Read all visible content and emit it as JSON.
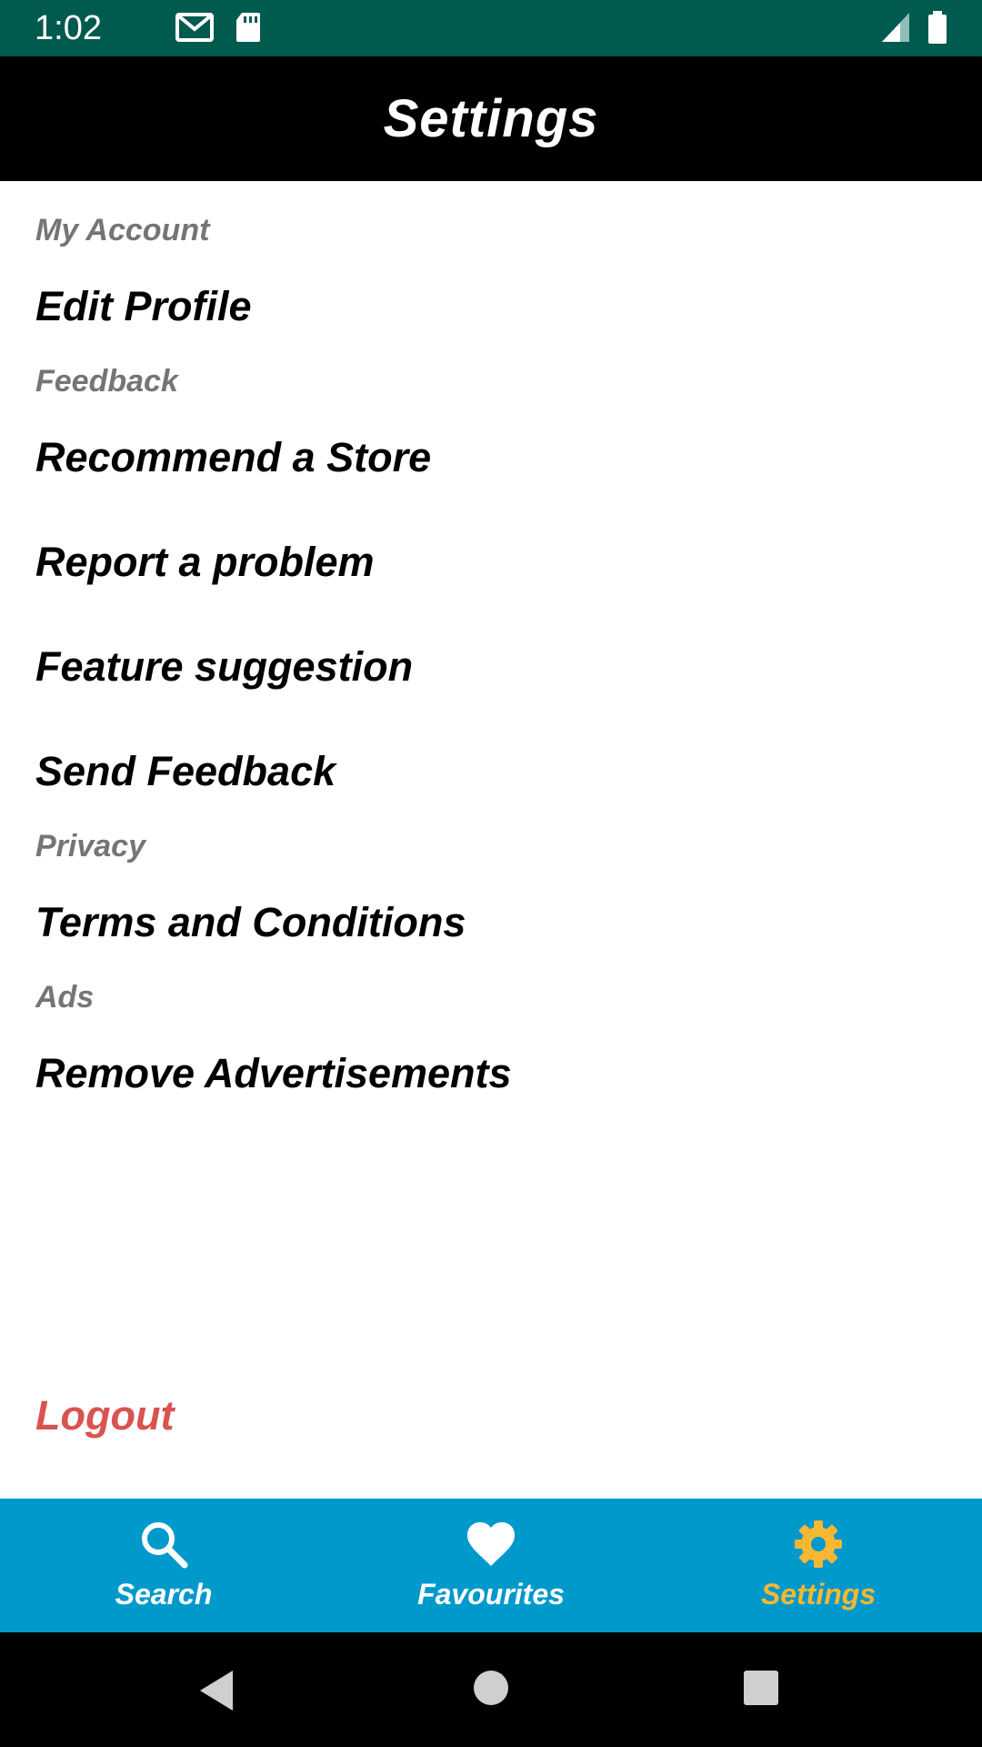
{
  "status_bar": {
    "time": "1:02",
    "icons": [
      "gmail-icon",
      "sd-card-icon",
      "signal-icon",
      "battery-icon"
    ]
  },
  "app_bar": {
    "title": "Settings"
  },
  "sections": [
    {
      "header": "My Account",
      "items": [
        "Edit Profile"
      ]
    },
    {
      "header": "Feedback",
      "items": [
        "Recommend a Store",
        "Report a problem",
        "Feature suggestion",
        "Send Feedback"
      ]
    },
    {
      "header": "Privacy",
      "items": [
        "Terms and Conditions"
      ]
    },
    {
      "header": "Ads",
      "items": [
        "Remove Advertisements"
      ]
    }
  ],
  "logout_label": "Logout",
  "bottom_nav": {
    "items": [
      {
        "label": "Search",
        "icon": "search-icon",
        "active": false
      },
      {
        "label": "Favourites",
        "icon": "heart-icon",
        "active": false
      },
      {
        "label": "Settings",
        "icon": "gear-icon",
        "active": true
      }
    ]
  },
  "colors": {
    "status_bar": "#005a4e",
    "app_bar": "#000000",
    "section_header": "#757575",
    "logout": "#d9534f",
    "bottom_nav": "#0099cc",
    "active_nav": "#f7b733"
  }
}
